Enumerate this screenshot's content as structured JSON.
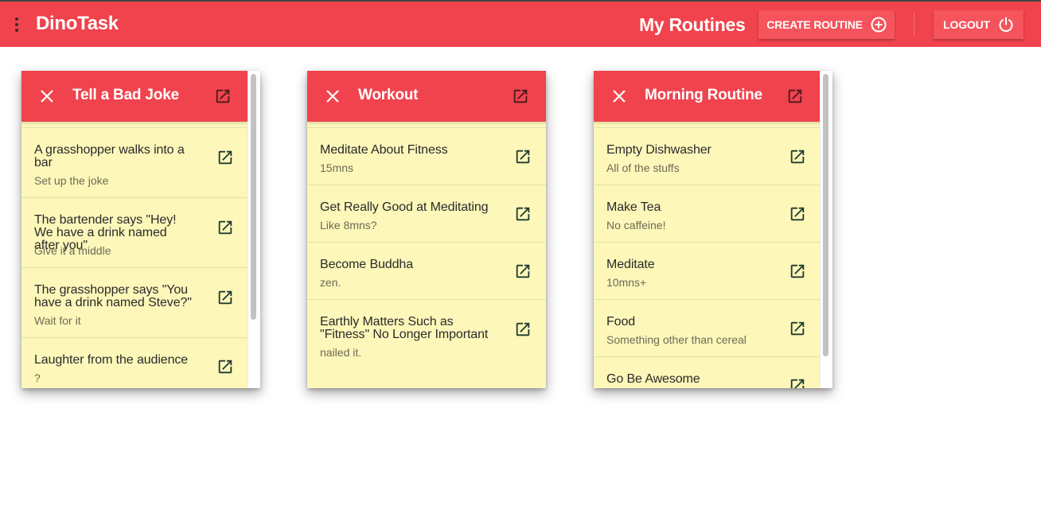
{
  "app": {
    "brand": "DinoTask",
    "page_title": "My Routines",
    "create_label": "CREATE ROUTINE",
    "logout_label": "LOGOUT",
    "colors": {
      "primary": "#f0434d",
      "card_bg": "#fdf7ba",
      "text": "#2a2a2a",
      "subtext": "#6d6a55"
    },
    "icons": {
      "menu": "more-vert-icon",
      "create": "plus-circle-icon",
      "logout": "power-icon",
      "close": "close-icon",
      "open": "open-in-new-icon"
    }
  },
  "routines": [
    {
      "title": "Tell a Bad Joke",
      "items": [
        {
          "title": "A grasshopper walks into a bar",
          "subtitle": "Set up the joke"
        },
        {
          "title": "The bartender says \"Hey! We have a drink named after you\"",
          "subtitle": "Give it a middle"
        },
        {
          "title": "The grasshopper says \"You have a drink named Steve?\"",
          "subtitle": "Wait for it"
        },
        {
          "title": "Laughter from the audience",
          "subtitle": "?"
        }
      ]
    },
    {
      "title": "Workout",
      "items": [
        {
          "title": "Meditate About Fitness",
          "subtitle": "15mns"
        },
        {
          "title": "Get Really Good at Meditating",
          "subtitle": "Like 8mns?"
        },
        {
          "title": "Become Buddha",
          "subtitle": "zen."
        },
        {
          "title": "Earthly Matters Such as \"Fitness\" No Longer Important",
          "subtitle": "nailed it."
        }
      ]
    },
    {
      "title": "Morning Routine",
      "items": [
        {
          "title": "Empty Dishwasher",
          "subtitle": "All of the stuffs"
        },
        {
          "title": "Make Tea",
          "subtitle": "No caffeine!"
        },
        {
          "title": "Meditate",
          "subtitle": "10mns+"
        },
        {
          "title": "Food",
          "subtitle": "Something other than cereal"
        },
        {
          "title": "Go Be Awesome",
          "subtitle": ""
        }
      ]
    }
  ]
}
